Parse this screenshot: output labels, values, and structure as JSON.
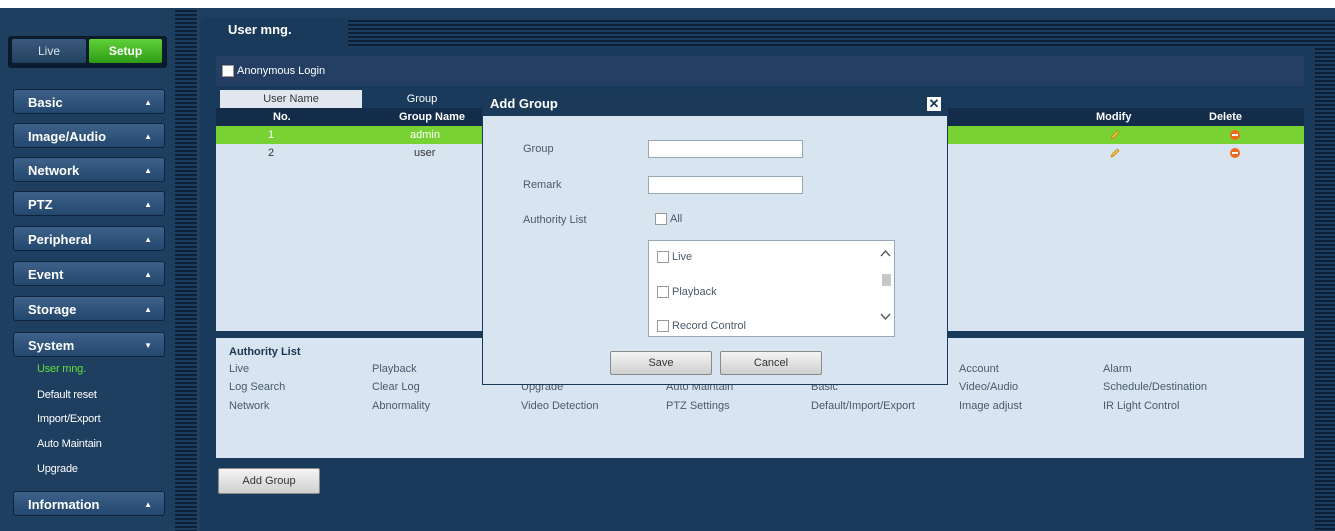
{
  "mode": {
    "live": "Live",
    "setup": "Setup"
  },
  "sidebar": {
    "items": [
      {
        "label": "Basic"
      },
      {
        "label": "Image/Audio"
      },
      {
        "label": "Network"
      },
      {
        "label": "PTZ"
      },
      {
        "label": "Peripheral"
      },
      {
        "label": "Event"
      },
      {
        "label": "Storage"
      },
      {
        "label": "System"
      },
      {
        "label": "Information"
      }
    ],
    "system_sub": [
      "User mng.",
      "Default reset",
      "Import/Export",
      "Auto Maintain",
      "Upgrade"
    ]
  },
  "page": {
    "tab": "User mng."
  },
  "anonymous_login": {
    "label": "Anonymous Login",
    "checked": false
  },
  "subtabs": {
    "user": "User Name",
    "group": "Group"
  },
  "table": {
    "headers": {
      "no": "No.",
      "group_name": "Group Name",
      "modify": "Modify",
      "delete": "Delete"
    },
    "rows": [
      {
        "no": "1",
        "name": "admin",
        "selected": true
      },
      {
        "no": "2",
        "name": "user",
        "selected": false
      }
    ]
  },
  "authority_panel": {
    "title": "Authority List",
    "items": [
      [
        "Live",
        "Playback",
        "",
        "",
        "",
        "Account",
        "Alarm"
      ],
      [
        "Log Search",
        "Clear Log",
        "Upgrade",
        "Auto Maintain",
        "Basic",
        "Video/Audio",
        "Schedule/Destination"
      ],
      [
        "Network",
        "Abnormality",
        "Video Detection",
        "PTZ Settings",
        "Default/Import/Export",
        "Image adjust",
        "IR Light Control"
      ]
    ]
  },
  "add_group_button": "Add Group",
  "dialog": {
    "title": "Add Group",
    "group_label": "Group",
    "group_value": "",
    "remark_label": "Remark",
    "remark_value": "",
    "authority_label": "Authority List",
    "all_label": "All",
    "authority_items": [
      "Live",
      "Playback",
      "Record Control"
    ],
    "save": "Save",
    "cancel": "Cancel"
  },
  "colors": {
    "selected_row": "#79d233",
    "delete_icon": "#ef6a1c",
    "active_submenu": "#5fe03a"
  }
}
